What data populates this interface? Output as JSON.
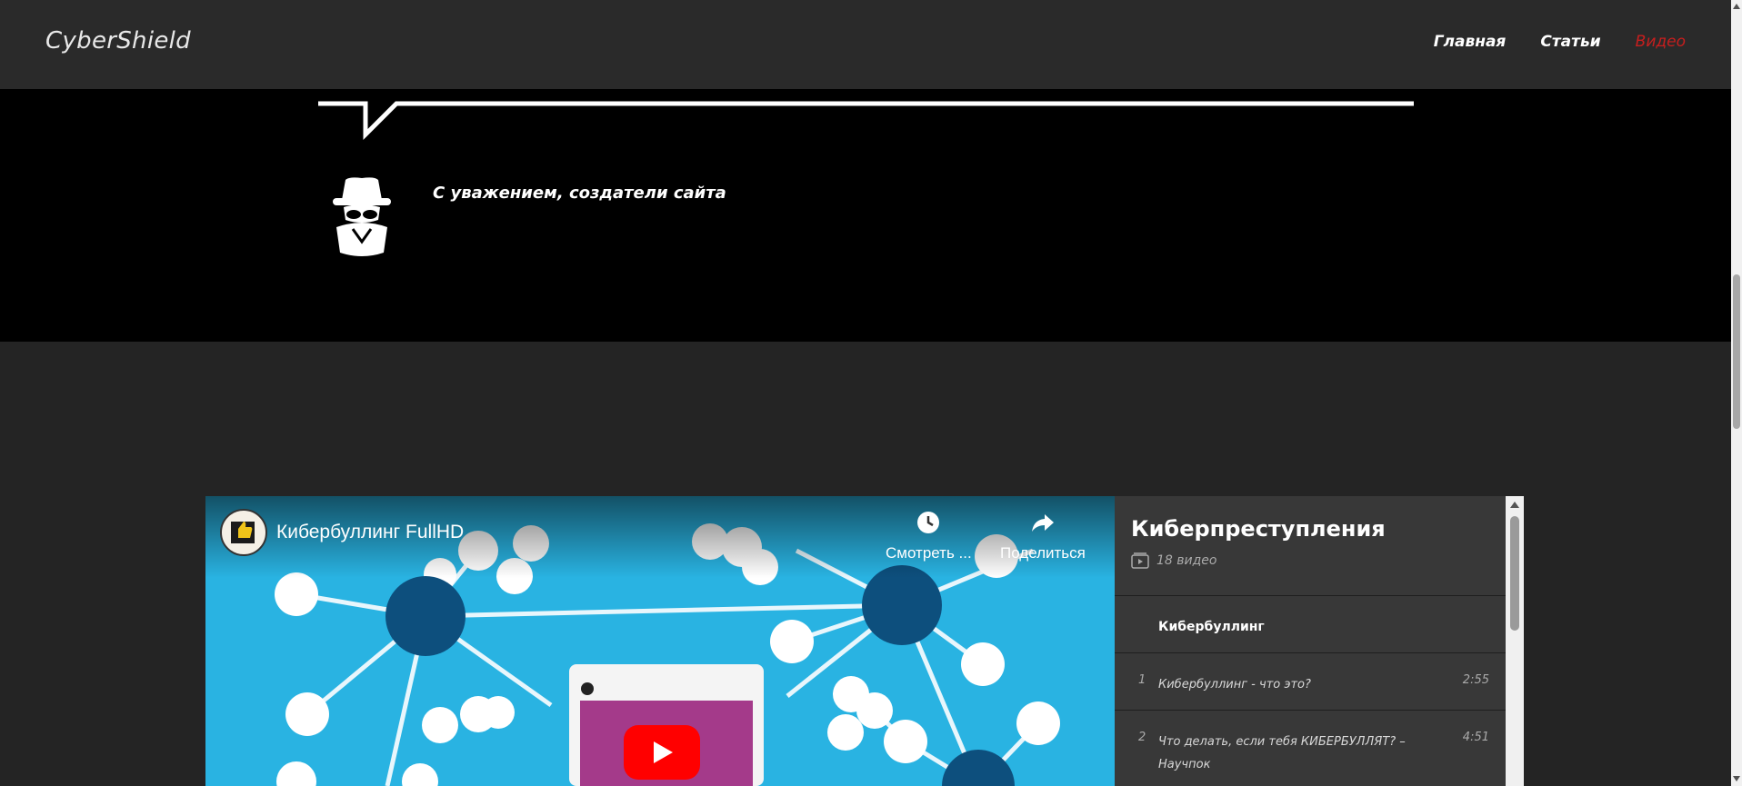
{
  "header": {
    "logo": "CyberShield",
    "nav": [
      {
        "label": "Главная",
        "active": false
      },
      {
        "label": "Статьи",
        "active": false
      },
      {
        "label": "Видео",
        "active": true
      }
    ],
    "active_color": "#c81e1e"
  },
  "signature": {
    "icon": "spy-icon",
    "text": "С уважением, создатели сайта"
  },
  "player": {
    "title": "Кибербуллинг FullHD",
    "watch_later_label": "Смотреть ...",
    "share_label": "Поделиться",
    "accent": "#29b3e2"
  },
  "playlist": {
    "title": "Киберпреступления",
    "count": "18 видео",
    "now_playing": "Кибербуллинг",
    "items": [
      {
        "num": "1",
        "title": "Кибербуллинг - что это?",
        "duration": "2:55"
      },
      {
        "num": "2",
        "title": "Что делать, если тебя КИБЕРБУЛЛЯТ? – Научпок",
        "duration": "4:51"
      }
    ]
  }
}
